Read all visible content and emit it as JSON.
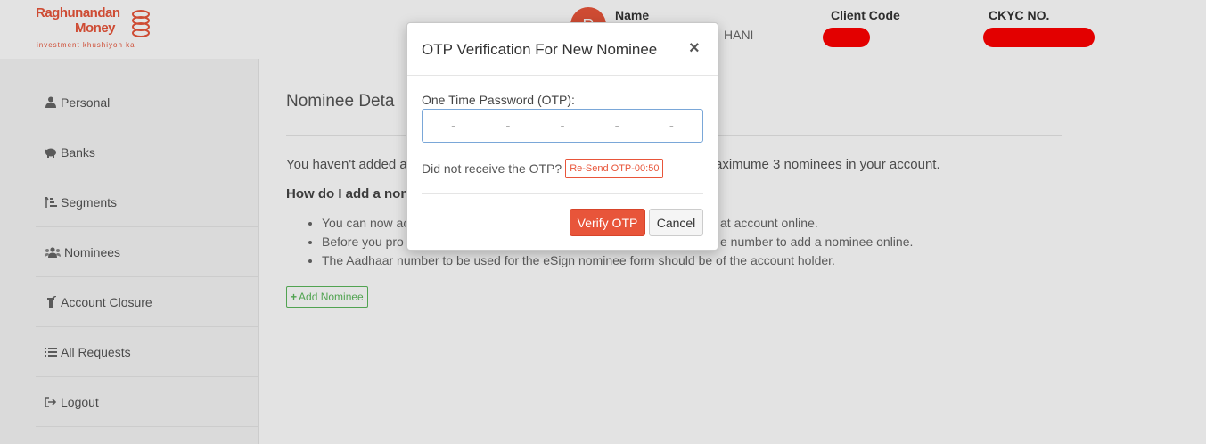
{
  "brand": {
    "name_line1": "Raghunandan",
    "name_line2": "Money",
    "tagline": "investment khushiyon ka",
    "color": "#e8553a"
  },
  "header": {
    "avatar_initial": "R",
    "name_label": "Name",
    "name_value": "HANI",
    "client_code_label": "Client Code",
    "ckyc_label": "CKYC NO.",
    "redaction_color": "#ff0000"
  },
  "sidebar": {
    "items": [
      {
        "label": "Personal",
        "icon": "user-icon"
      },
      {
        "label": "Banks",
        "icon": "piggy-bank-icon"
      },
      {
        "label": "Segments",
        "icon": "sort-amount-icon"
      },
      {
        "label": "Nominees",
        "icon": "users-icon"
      },
      {
        "label": "Account Closure",
        "icon": "fire-extinguisher-icon"
      },
      {
        "label": "All Requests",
        "icon": "list-icon"
      },
      {
        "label": "Logout",
        "icon": "sign-out-icon"
      }
    ]
  },
  "main": {
    "title": "Nominee Deta",
    "intro_left": "You haven't added a",
    "intro_right": "aximume 3 nominees in your account.",
    "how_to": "How do I add a nom",
    "bullets": [
      {
        "left": "You can now ac",
        "right": "at account online."
      },
      {
        "left": "Before you pro",
        "right": "e number to add a nominee online."
      },
      {
        "left": "The Aadhaar number to be used for the eSign nominee form should be of the account holder.",
        "right": ""
      }
    ],
    "add_button": "Add Nominee"
  },
  "modal": {
    "title": "OTP Verification For New Nominee",
    "close": "×",
    "otp_label": "One Time Password (OTP):",
    "otp_placeholder": "- - - - -",
    "resend_prompt": "Did not receive the OTP?",
    "resend_button": "Re-Send OTP-00:50",
    "verify_button": "Verify OTP",
    "cancel_button": "Cancel"
  }
}
